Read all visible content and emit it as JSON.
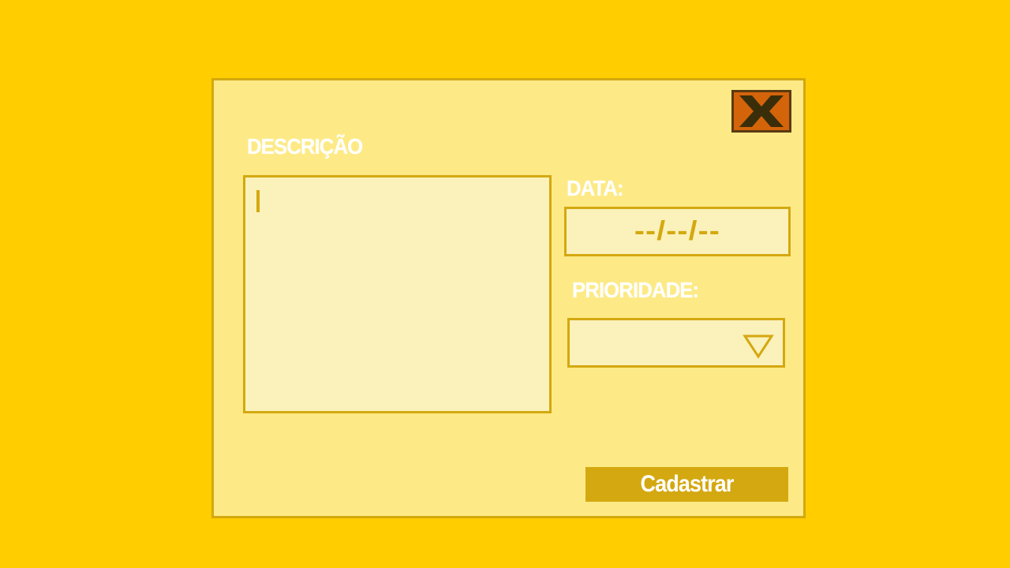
{
  "form": {
    "description_label": "DESCRIÇÃO",
    "description_value": "",
    "date_label": "DATA:",
    "date_mask": "--/--/--",
    "priority_label": "PRIORIDADE:",
    "priority_value": "",
    "submit_label": "Cadastrar"
  },
  "icons": {
    "close": "close-x-icon",
    "dropdown": "triangle-down-icon"
  },
  "colors": {
    "background": "#FFCD00",
    "dialog": "#FDEA86",
    "field": "#FBF1BA",
    "border": "#D4A810",
    "close_button": "#D4640A",
    "close_icon": "#3A2E0A",
    "label_text": "#FFFFFF"
  }
}
